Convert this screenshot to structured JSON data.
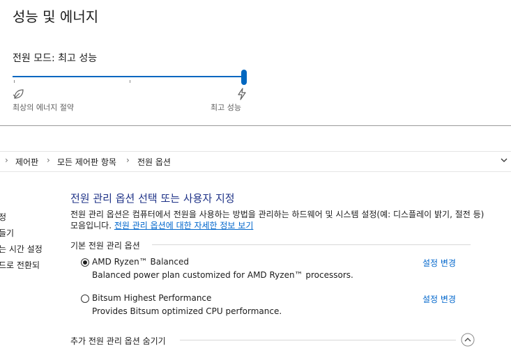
{
  "settings": {
    "title": "성능 및 에너지",
    "mode_label": "전원 모드: 최고 성능",
    "slider": {
      "value_fraction": 1.0,
      "ticks": 3
    },
    "left_label": "최상의 에너지 절약",
    "right_label": "최고 성능",
    "left_icon": "leaf-icon",
    "right_icon": "lightning-icon"
  },
  "control_panel": {
    "breadcrumb": [
      "제어판",
      "모든 제어판 항목",
      "전원 옵션"
    ],
    "sidebar": [
      "정",
      "들기",
      "는 시간 설정",
      "드로 전환되"
    ],
    "heading": "전원 관리 옵션 선택 또는 사용자 지정",
    "description": "전원 관리 옵션은 컴퓨터에서 전원을 사용하는 방법을 관리하는 하드웨어 및 시스템 설정(예: 디스플레이 밝기, 절전 등) 모음입니다. ",
    "description_link": "전원 관리 옵션에 대한 자세한 정보 보기",
    "group_label": "기본 전원 관리 옵션",
    "plans": [
      {
        "name": "AMD Ryzen™ Balanced",
        "description": "Balanced power plan customized for AMD Ryzen™ processors.",
        "selected": true,
        "change_label": "설정 변경"
      },
      {
        "name": "Bitsum Highest Performance",
        "description": "Provides Bitsum optimized CPU performance.",
        "selected": false,
        "change_label": "설정 변경"
      }
    ],
    "more_label": "추가 전원 관리 옵션 숨기기"
  },
  "colors": {
    "accent": "#0067c0",
    "link": "#0066cc",
    "heading": "#1e3287"
  }
}
